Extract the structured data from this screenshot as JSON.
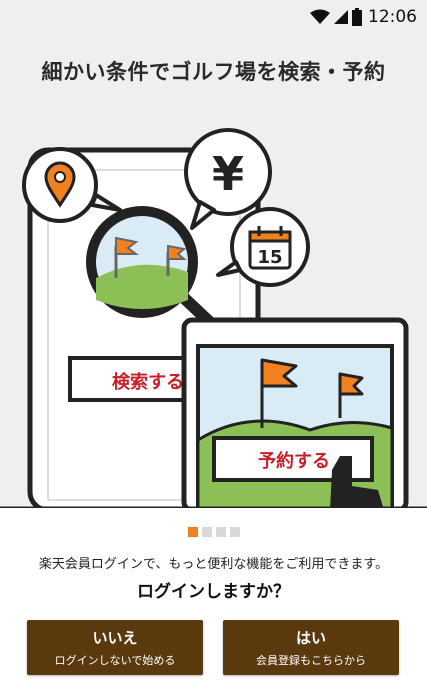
{
  "status_bar": {
    "time": "12:06"
  },
  "headline": "細かい条件でゴルフ場を検索・予約",
  "illustration": {
    "search_button_label": "検索する",
    "reserve_button_label": "予約する",
    "currency_symbol": "¥",
    "calendar_day": "15"
  },
  "pager": {
    "active_index": 0,
    "count": 4
  },
  "message": {
    "info": "楽天会員ログインで、もっと便利な機能をご利用できます。",
    "question": "ログインしますか？"
  },
  "buttons": {
    "no": {
      "main": "いいえ",
      "sub": "ログインしないで始める"
    },
    "yes": {
      "main": "はい",
      "sub": "会員登録もこちらから"
    }
  },
  "colors": {
    "accent": "#f08020",
    "button_brown": "#5b390f",
    "red_text": "#c8202a"
  }
}
